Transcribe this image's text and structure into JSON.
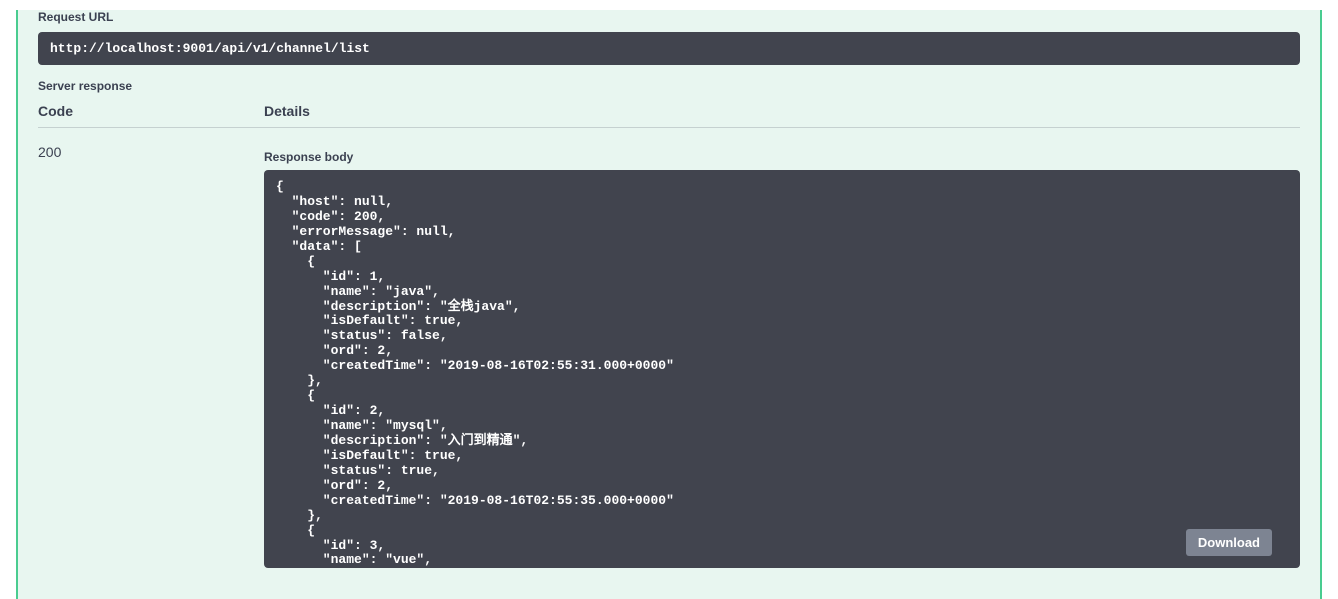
{
  "labels": {
    "request_url": "Request URL",
    "server_response": "Server response",
    "code_header": "Code",
    "details_header": "Details",
    "response_body": "Response body",
    "download": "Download"
  },
  "request_url": "http://localhost:9001/api/v1/channel/list",
  "response": {
    "code": "200",
    "body": "{\n  \"host\": null,\n  \"code\": 200,\n  \"errorMessage\": null,\n  \"data\": [\n    {\n      \"id\": 1,\n      \"name\": \"java\",\n      \"description\": \"全栈java\",\n      \"isDefault\": true,\n      \"status\": false,\n      \"ord\": 2,\n      \"createdTime\": \"2019-08-16T02:55:31.000+0000\"\n    },\n    {\n      \"id\": 2,\n      \"name\": \"mysql\",\n      \"description\": \"入门到精通\",\n      \"isDefault\": true,\n      \"status\": true,\n      \"ord\": 2,\n      \"createdTime\": \"2019-08-16T02:55:35.000+0000\"\n    },\n    {\n      \"id\": 3,\n      \"name\": \"vue\","
  }
}
